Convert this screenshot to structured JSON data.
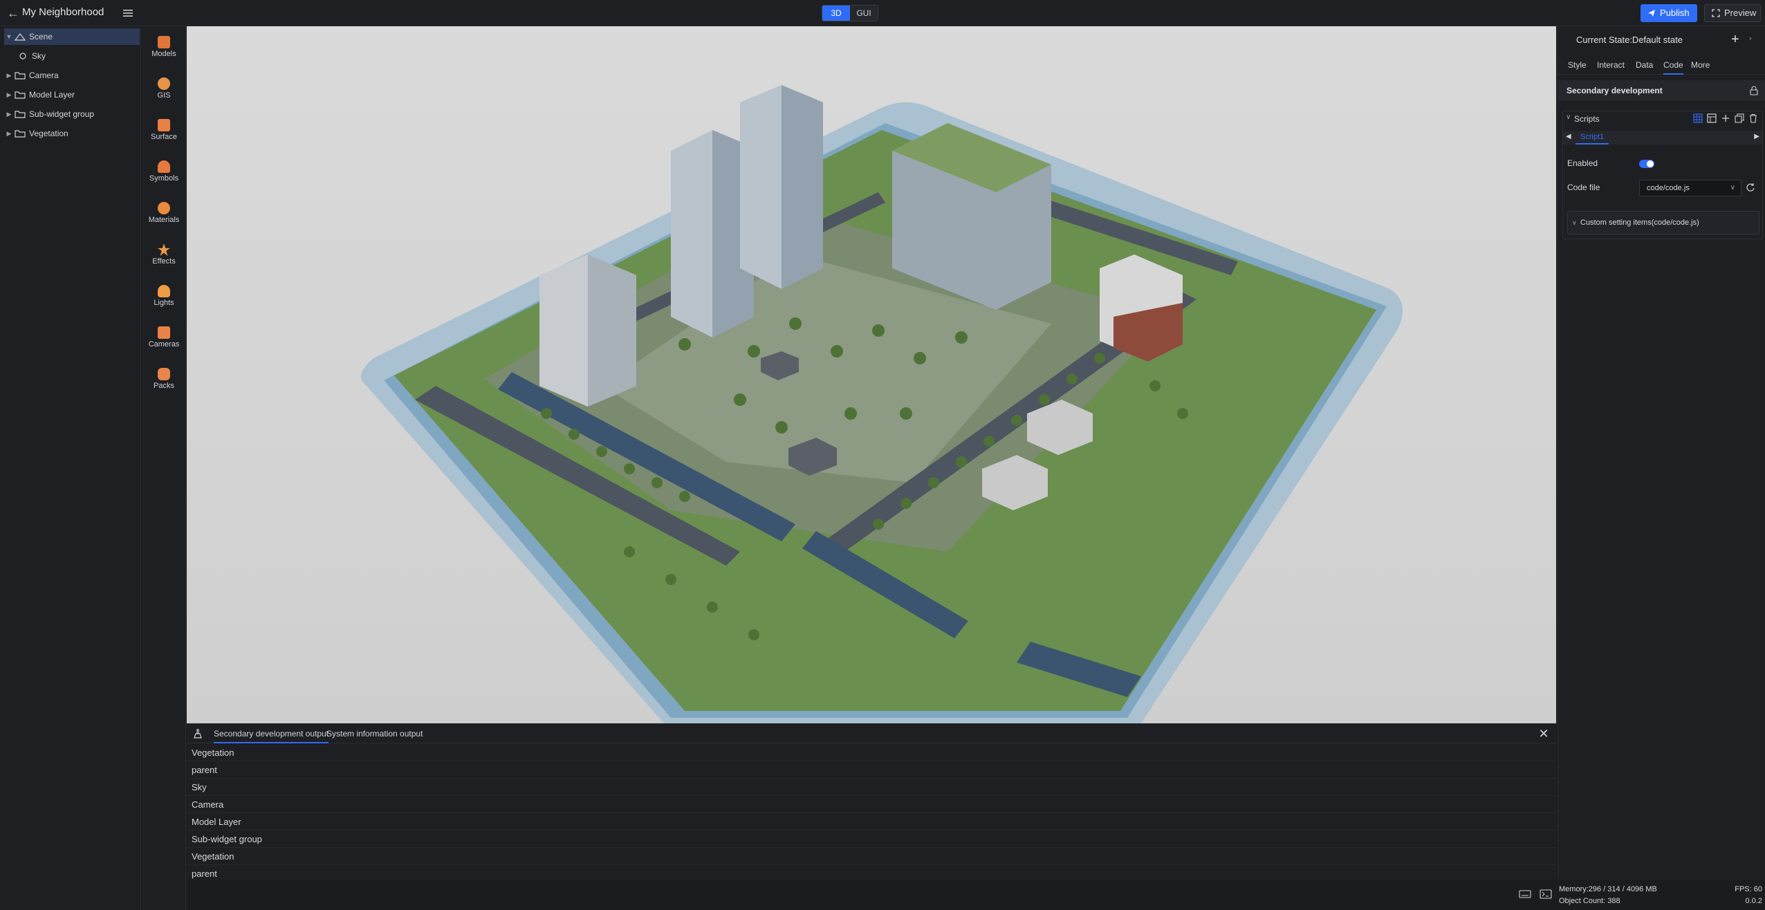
{
  "header": {
    "app_title": "My Neighborhood",
    "modes": [
      "3D",
      "GUI"
    ],
    "active_mode": "3D",
    "publish_label": "Publish",
    "preview_label": "Preview"
  },
  "tree": {
    "items": [
      {
        "label": "Scene",
        "expanded": true,
        "selected": true
      },
      {
        "label": "Sky"
      },
      {
        "label": "Camera"
      },
      {
        "label": "Model Layer"
      },
      {
        "label": "Sub-widget group"
      },
      {
        "label": "Vegetation"
      }
    ]
  },
  "tools": [
    {
      "label": "Models",
      "color": "#e0763a"
    },
    {
      "label": "GIS",
      "color": "#e8934a"
    },
    {
      "label": "Surface",
      "color": "#e98045"
    },
    {
      "label": "Symbols",
      "color": "#e77a3f"
    },
    {
      "label": "Materials",
      "color": "#ea8a3d"
    },
    {
      "label": "Effects",
      "color": "#ee9a44"
    },
    {
      "label": "Lights",
      "color": "#ef9d45"
    },
    {
      "label": "Cameras",
      "color": "#e98246"
    },
    {
      "label": "Packs",
      "color": "#e9864a"
    }
  ],
  "output": {
    "tabs": [
      "Secondary development output",
      "System information output"
    ],
    "lines": [
      "Vegetation",
      "parent",
      "Sky",
      "Camera",
      "Model Layer",
      "Sub-widget group",
      "Vegetation",
      "parent"
    ]
  },
  "status": {
    "memory": "Memory:296 / 314 / 4096 MB",
    "object_count": "Object Count: 388",
    "fps": "FPS: 60",
    "version": "0.0.2"
  },
  "right": {
    "title": "Current State:Default state",
    "tabs": [
      "Style",
      "Interact",
      "Data",
      "Code",
      "More"
    ],
    "active_tab": "Code",
    "section": "Secondary development",
    "scripts_label": "Scripts",
    "script_tab": "Script1",
    "enabled_label": "Enabled",
    "code_file_label": "Code file",
    "code_file_value": "code/code.js",
    "custom_items": "Custom setting items(code/code.js)"
  },
  "colors": {
    "accent": "#2f6cf6",
    "panel": "#1e1f23",
    "viewport": "#d3d3d3"
  }
}
